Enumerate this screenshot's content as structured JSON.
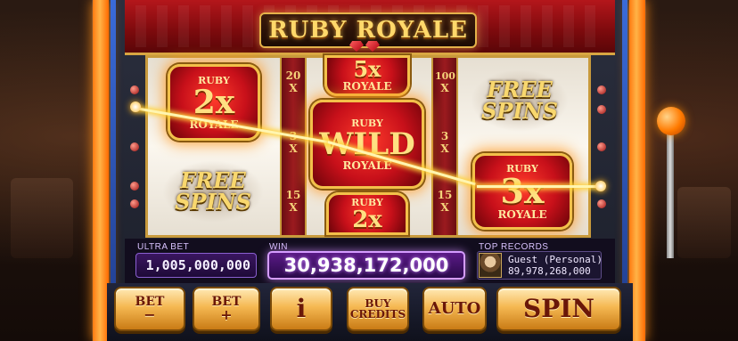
{
  "game": {
    "title": "RUBY ROYALE"
  },
  "reels": {
    "reel1": [
      {
        "type": "multiplier",
        "top": "RUBY",
        "value": "2x",
        "bottom": "ROYALE"
      },
      {
        "type": "free",
        "line1": "FREE",
        "line2": "SPINS"
      }
    ],
    "reel2": [
      {
        "type": "multiplier",
        "value": "5x",
        "bottom": "ROYALE"
      },
      {
        "type": "wild",
        "top": "RUBY",
        "value": "WILD",
        "bottom": "ROYALE"
      },
      {
        "type": "multiplier",
        "top": "RUBY",
        "value": "2x"
      }
    ],
    "reel3": [
      {
        "type": "free",
        "line1": "FREE",
        "line2": "SPINS"
      },
      {
        "type": "multiplier",
        "top": "RUBY",
        "value": "3x",
        "bottom": "ROYALE"
      }
    ],
    "strip1": [
      "20",
      "X",
      "3",
      "X",
      "15",
      "X"
    ],
    "strip2": [
      "100",
      "X",
      "3",
      "X",
      "15",
      "X"
    ]
  },
  "info": {
    "bet_label": "ULTRA BET",
    "bet_value": "1,005,000,000",
    "win_label": "WIN",
    "win_value": "30,938,172,000",
    "records_label": "TOP RECORDS",
    "record_name": "Guest (Personal)",
    "record_score": "89,978,268,000"
  },
  "buttons": {
    "bet_minus": {
      "line1": "BET",
      "line2": "−"
    },
    "bet_plus": {
      "line1": "BET",
      "line2": "+"
    },
    "info": "i",
    "buy_credits": {
      "line1": "BUY",
      "line2": "CREDITS"
    },
    "auto": "AUTO",
    "spin": "SPIN"
  },
  "colors": {
    "ruby": "#c8101a",
    "gold": "#f3c04a",
    "glow": "#ffd23a",
    "side_rail": "#ff7a10",
    "win_purple": "#5a1a86"
  }
}
